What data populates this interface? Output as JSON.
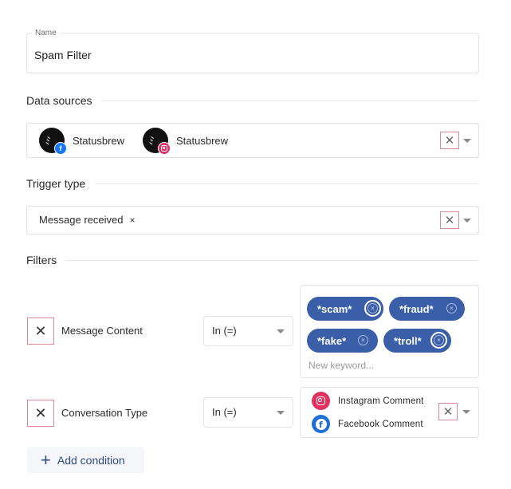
{
  "name_field": {
    "label": "Name",
    "value": "Spam Filter"
  },
  "data_sources": {
    "title": "Data sources",
    "items": [
      {
        "name": "Statusbrew",
        "network": "facebook",
        "network_color": "#1877f2"
      },
      {
        "name": "Statusbrew",
        "network": "instagram",
        "network_color": "#e1306c"
      }
    ],
    "clear_icon": "✕"
  },
  "trigger_type": {
    "title": "Trigger type",
    "value": "Message received",
    "remove_icon": "×",
    "clear_icon": "✕"
  },
  "filters": {
    "title": "Filters",
    "conditions": [
      {
        "remove_icon": "✕",
        "field": "Message Content",
        "operator": "In (=)",
        "keywords": [
          "*scam*",
          "*fraud*",
          "*fake*",
          "*troll*"
        ],
        "keyword_remove_icon": "×",
        "keyword_placeholder": "New keyword..."
      },
      {
        "remove_icon": "✕",
        "field": "Conversation Type",
        "operator": "In (=)",
        "values": [
          {
            "label": "Instagram Comment",
            "icon": "instagram-icon",
            "color": "#e0325f"
          },
          {
            "label": "Facebook Comment",
            "icon": "facebook-icon",
            "color": "#1f6fd6"
          }
        ],
        "clear_icon": "✕"
      }
    ],
    "add_condition_label": "Add condition",
    "add_icon": "+"
  },
  "colors": {
    "chip": "#3a5ea8",
    "accent_text": "#324b7a",
    "highlight_border": "#d98a92"
  }
}
